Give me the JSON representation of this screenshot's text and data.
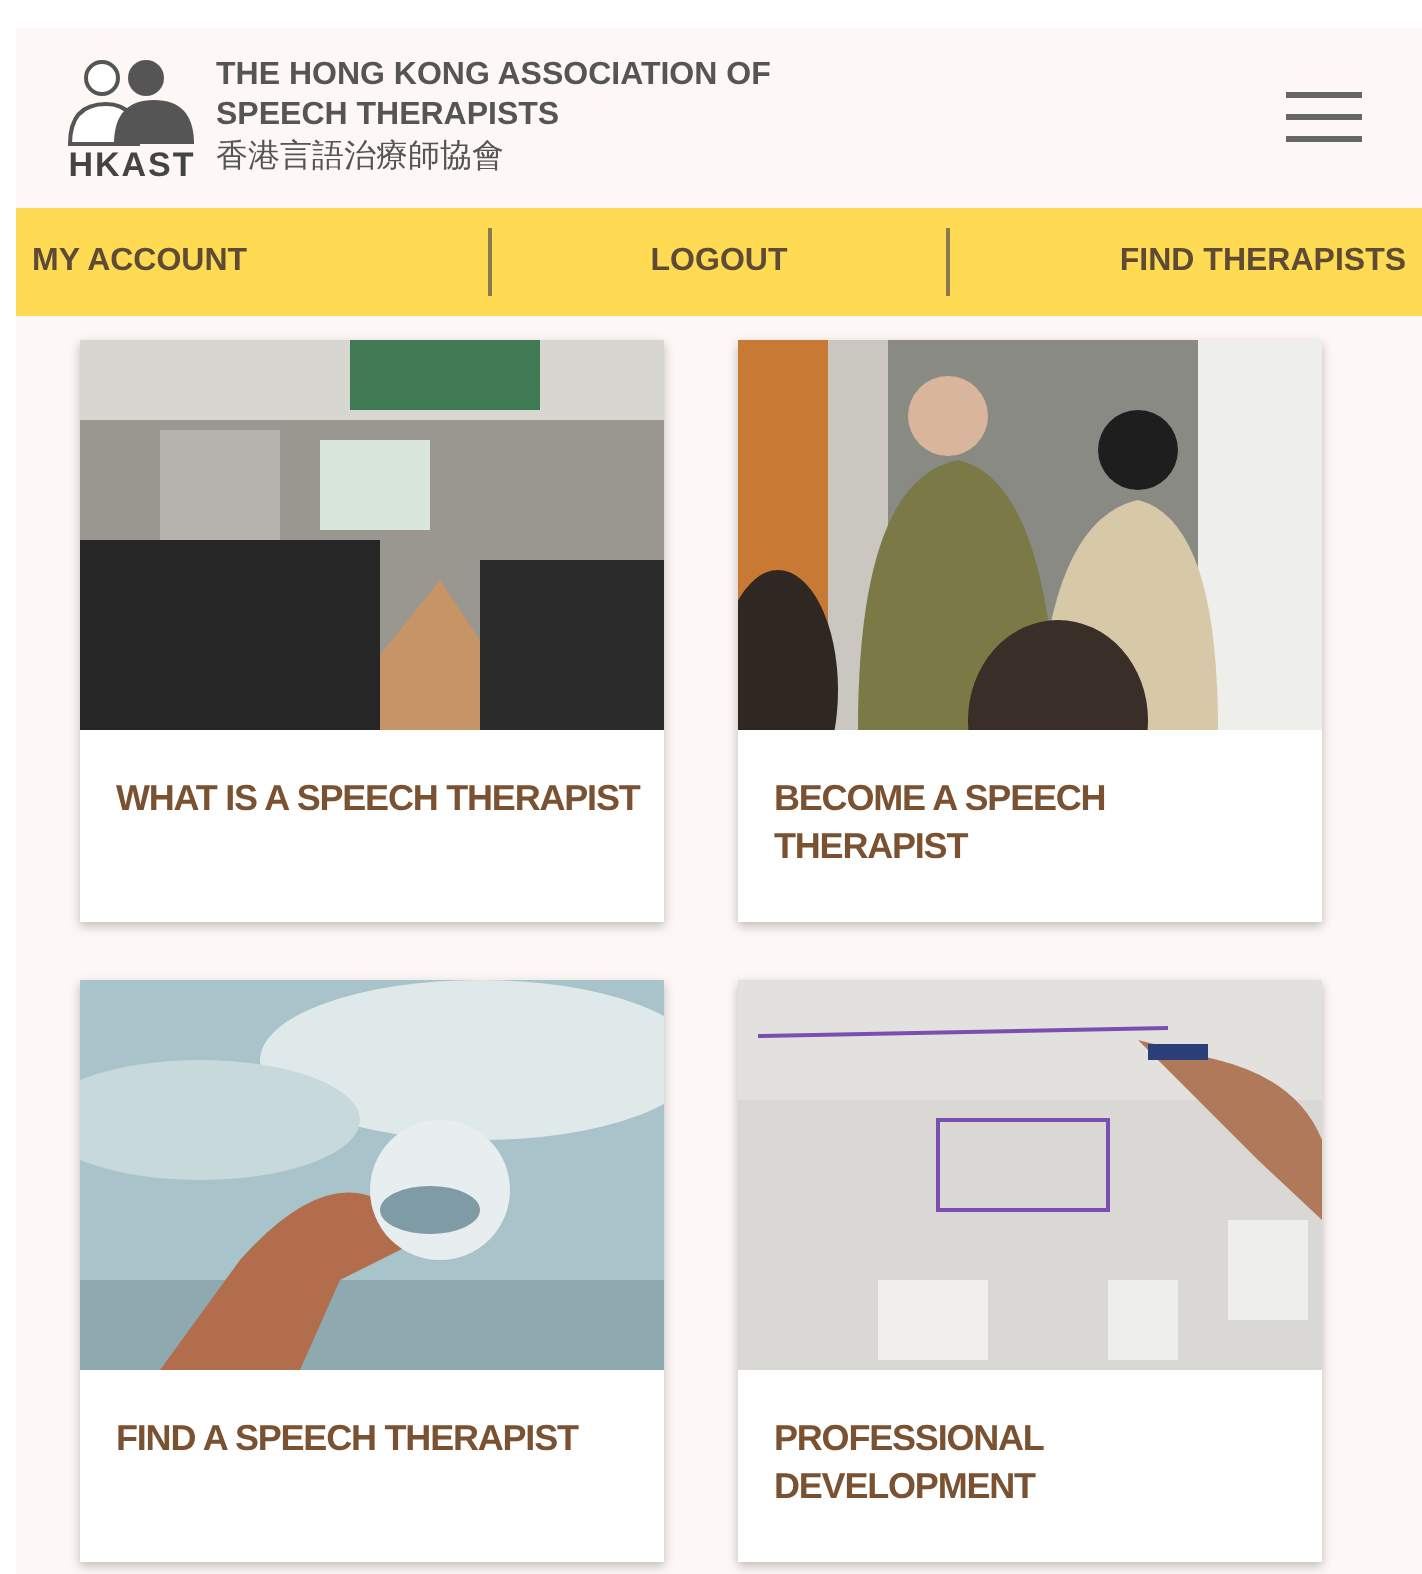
{
  "header": {
    "logo_mark": "HKAST",
    "title_en_line1": "THE HONG KONG ASSOCIATION OF",
    "title_en_line2": "SPEECH THERAPISTS",
    "title_zh": "香港言語治療師協會"
  },
  "nav": [
    {
      "label": "MY ACCOUNT"
    },
    {
      "label": "LOGOUT"
    },
    {
      "label": "FIND THERAPISTS"
    }
  ],
  "cards": [
    {
      "title": "WHAT IS A SPEECH THERAPIST"
    },
    {
      "title": "BECOME A SPEECH THERAPIST"
    },
    {
      "title": "FIND A SPEECH THERAPIST"
    },
    {
      "title": "PROFESSIONAL DEVELOPMENT"
    }
  ]
}
